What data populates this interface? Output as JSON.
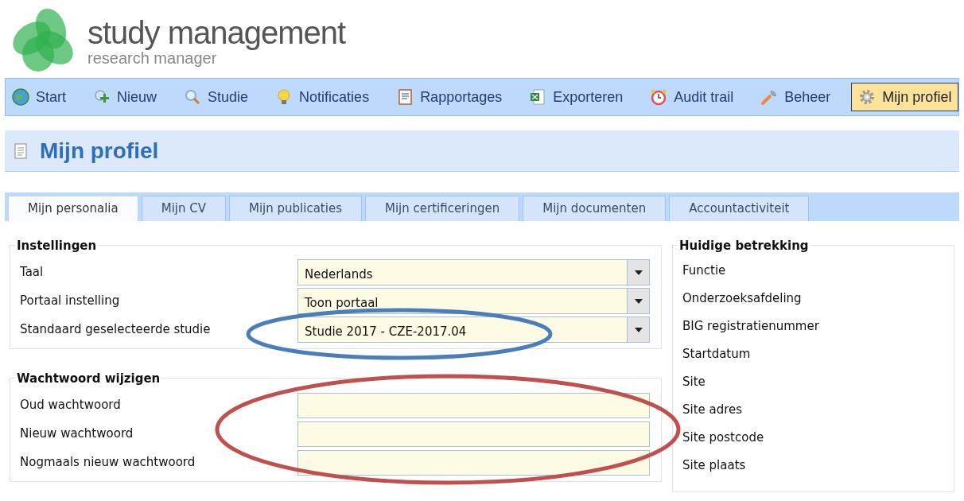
{
  "header": {
    "title": "study management",
    "subtitle": "research manager"
  },
  "nav": [
    {
      "label": "Start",
      "kind": "globe",
      "selected": false
    },
    {
      "label": "Nieuw",
      "kind": "new",
      "selected": false
    },
    {
      "label": "Studie",
      "kind": "search",
      "selected": false
    },
    {
      "label": "Notificaties",
      "kind": "bulb",
      "selected": false
    },
    {
      "label": "Rapportages",
      "kind": "report",
      "selected": false
    },
    {
      "label": "Exporteren",
      "kind": "excel",
      "selected": false
    },
    {
      "label": "Audit trail",
      "kind": "clock",
      "selected": false
    },
    {
      "label": "Beheer",
      "kind": "wrench",
      "selected": false
    },
    {
      "label": "Mijn profiel",
      "kind": "gear",
      "selected": true
    }
  ],
  "page_title": "Mijn profiel",
  "tabs": [
    {
      "label": "Mijn personalia",
      "selected": true
    },
    {
      "label": "Mijn CV",
      "selected": false
    },
    {
      "label": "Mijn publicaties",
      "selected": false
    },
    {
      "label": "Mijn certificeringen",
      "selected": false
    },
    {
      "label": "Mijn documenten",
      "selected": false
    },
    {
      "label": "Accountactiviteit",
      "selected": false
    }
  ],
  "settings": {
    "legend": "Instellingen",
    "fields": [
      {
        "label": "Taal",
        "kind": "select",
        "value": "Nederlands"
      },
      {
        "label": "Portaal instelling",
        "kind": "select",
        "value": "Toon portaal"
      },
      {
        "label": "Standaard geselecteerde studie",
        "kind": "select",
        "value": "Studie 2017 - CZE-2017.04"
      }
    ]
  },
  "password": {
    "legend": "Wachtwoord wijzigen",
    "fields": [
      {
        "label": "Oud wachtwoord",
        "kind": "password"
      },
      {
        "label": "Nieuw wachtwoord",
        "kind": "password"
      },
      {
        "label": "Nogmaals nieuw wachtwoord",
        "kind": "password"
      }
    ]
  },
  "employment": {
    "legend": "Huidige betrekking",
    "items": [
      "Functie",
      "Onderzoeksafdeling",
      "BIG registratienummer",
      "Startdatum",
      "Site",
      "Site adres",
      "Site postcode",
      "Site plaats"
    ]
  }
}
